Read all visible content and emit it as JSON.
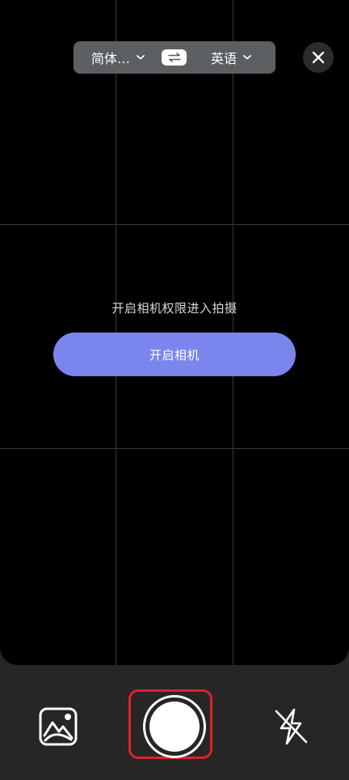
{
  "language_bar": {
    "source_label": "简体…",
    "target_label": "英语"
  },
  "permission": {
    "message": "开启相机权限进入拍摄",
    "button_label": "开启相机"
  },
  "icons": {
    "chevron": "chevron-down-icon",
    "swap": "swap-arrows-icon",
    "close": "close-icon",
    "gallery": "gallery-icon",
    "shutter": "shutter-icon",
    "flash": "flash-off-icon"
  },
  "colors": {
    "accent": "#7b85ee",
    "highlight": "#e0202a",
    "viewfinder": "#000000",
    "toolbar": "#262626"
  }
}
